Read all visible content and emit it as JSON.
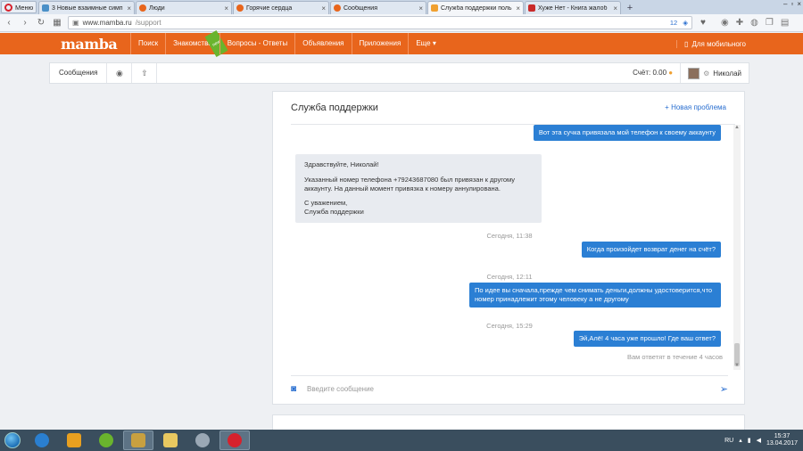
{
  "browser": {
    "menu_label": "Меню",
    "tabs": [
      {
        "title": "3 Новые взаимные симп",
        "color": "#4a90c8"
      },
      {
        "title": "Люди",
        "color": "#e8651c"
      },
      {
        "title": "Горячие сердца",
        "color": "#e8651c"
      },
      {
        "title": "Сообщения",
        "color": "#e8651c"
      },
      {
        "title": "Служба поддержки поль",
        "color": "#f0a030"
      },
      {
        "title": "Хуже Нет - Книга жалоб",
        "color": "#c92a2a"
      }
    ],
    "address": {
      "host": "www.mamba.ru",
      "path": "/support",
      "badge_count": "12"
    }
  },
  "site": {
    "logo": "mamba",
    "nav": [
      {
        "label": "Поиск"
      },
      {
        "label": "Знакомства",
        "badge": "new"
      },
      {
        "label": "Вопросы - Ответы"
      },
      {
        "label": "Объявления"
      },
      {
        "label": "Приложения"
      },
      {
        "label": "Еще ▾"
      }
    ],
    "mobile_label": "Для мобильного"
  },
  "subbar": {
    "messages_label": "Сообщения",
    "score_label": "Счёт: 0.00",
    "user_name": "Николай"
  },
  "support": {
    "title": "Служба поддержки",
    "new_problem_label": "Новая проблема",
    "messages": {
      "m1": "Вот эта сучка привязала мой телефон к своему аккаунту",
      "reply_greeting": "Здравствуйте, Николай!",
      "reply_body": "Указанный номер телефона +79243687080 был привязан к другому аккаунту. На данный момент привязка к номеру аннулирована.",
      "reply_sign1": "С уважением,",
      "reply_sign2": "Служба поддержки",
      "ts1": "Сегодня, 11:38",
      "m2": "Когда произойдет возврат денег на счёт?",
      "ts2": "Сегодня, 12:11",
      "m3": "По идее вы сначала,прежде чем снимать деньги,должны удостоверится,что номер принадлежит этому человеку а не другому",
      "ts3": "Сегодня, 15:29",
      "m4": "Эй,Алё! 4 часа уже прошло! Где ваш ответ?",
      "reply_hint": "Вам ответят в течение 4 часов"
    },
    "composer_placeholder": "Введите сообщение"
  },
  "taskbar": {
    "lang": "RU",
    "time": "15:37",
    "date": "13.04.2017"
  }
}
